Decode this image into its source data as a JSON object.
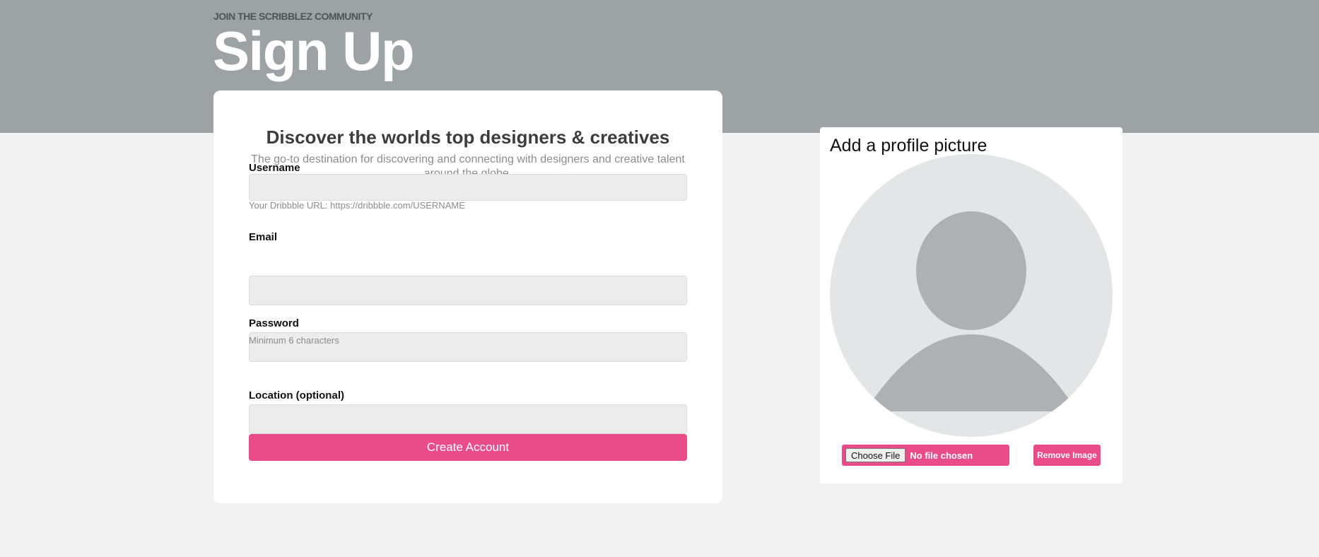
{
  "header": {
    "eyebrow": "JOIN THE SCRIBBLEZ COMMUNITY",
    "title": "Sign Up"
  },
  "form": {
    "heading": "Discover the worlds top designers & creatives",
    "subheading": "The go-to destination for discovering and connecting with designers and creative talent around the globe.",
    "username": {
      "label": "Username",
      "value": "",
      "hint": "Your Dribbble URL: https://dribbble.com/USERNAME"
    },
    "email": {
      "label": "Email",
      "value": ""
    },
    "password": {
      "label": "Password",
      "value": "",
      "hint": "Minimum 6 characters"
    },
    "location": {
      "label": "Location (optional)",
      "value": ""
    },
    "submit_label": "Create Account"
  },
  "profile": {
    "heading": "Add a profile picture",
    "choose_file_label": "Choose File",
    "file_status": "No file chosen",
    "remove_label": "Remove Image",
    "avatar_icon": "default-user-silhouette-icon"
  },
  "colors": {
    "accent": "#ea4c89",
    "hero": "#9da2a5",
    "background": "#f2f2f2"
  }
}
